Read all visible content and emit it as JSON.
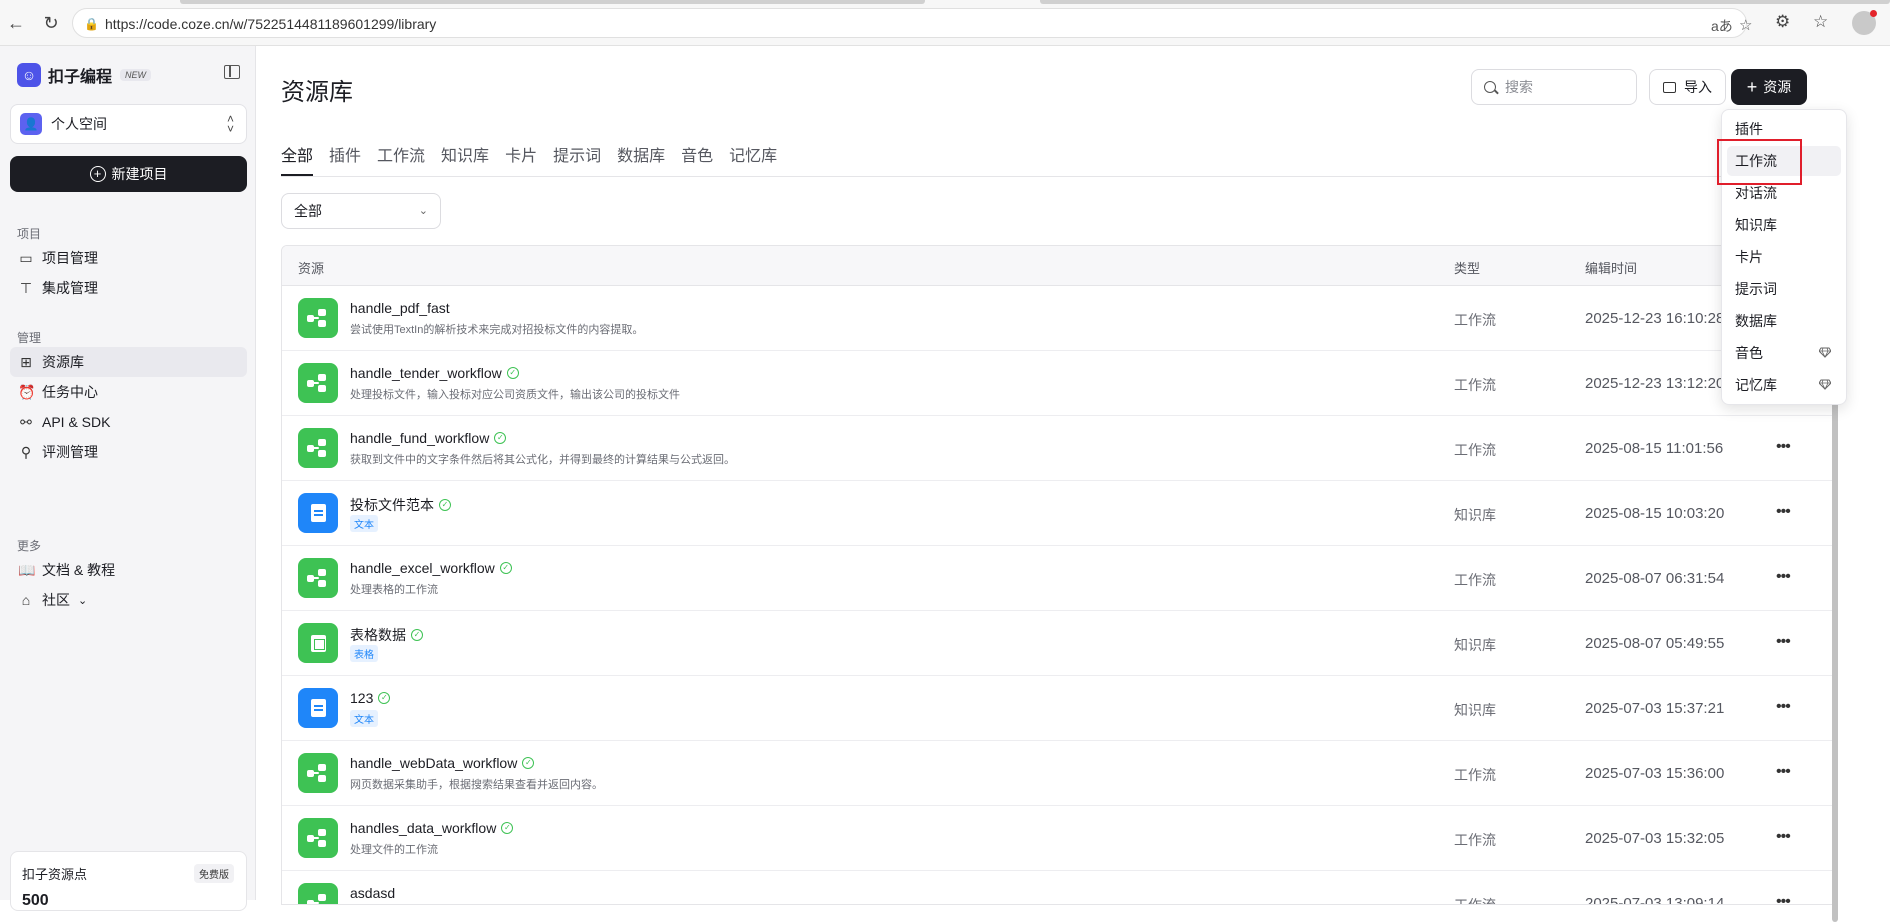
{
  "browser": {
    "url": "https://code.coze.cn/w/7522514481189601299/library"
  },
  "sidebar": {
    "logo_text": "扣子编程",
    "new_badge": "NEW",
    "space_label": "个人空间",
    "new_project_label": "新建项目",
    "sections": [
      {
        "title": "项目",
        "items": [
          {
            "label": "项目管理"
          },
          {
            "label": "集成管理"
          }
        ]
      },
      {
        "title": "管理",
        "items": [
          {
            "label": "资源库"
          },
          {
            "label": "任务中心"
          },
          {
            "label": "API & SDK"
          },
          {
            "label": "评测管理"
          }
        ]
      },
      {
        "title": "更多",
        "items": [
          {
            "label": "文档 & 教程"
          },
          {
            "label": "社区"
          }
        ]
      }
    ],
    "points_title": "扣子资源点",
    "points_badge": "免费版",
    "points_value": "500"
  },
  "main": {
    "title": "资源库",
    "search_placeholder": "搜索",
    "import_label": "导入",
    "resource_label": "资源",
    "tabs": [
      "全部",
      "插件",
      "工作流",
      "知识库",
      "卡片",
      "提示词",
      "数据库",
      "音色",
      "记忆库"
    ],
    "filter_value": "全部",
    "columns": {
      "resource": "资源",
      "type": "类型",
      "edited": "编辑时间"
    },
    "rows": [
      {
        "name": "handle_pdf_fast",
        "desc": "尝试使用TextIn的解析技术来完成对招投标文件的内容提取。",
        "type": "工作流",
        "time": "2025-12-23 16:10:28"
      },
      {
        "name": "handle_tender_workflow",
        "desc": "处理投标文件，输入投标对应公司资质文件，输出该公司的投标文件",
        "type": "工作流",
        "time": "2025-12-23 13:12:20"
      },
      {
        "name": "handle_fund_workflow",
        "desc": "获取到文件中的文字条件然后将其公式化，并得到最终的计算结果与公式返回。",
        "type": "工作流",
        "time": "2025-08-15 11:01:56"
      },
      {
        "name": "投标文件范本",
        "tag": "文本",
        "type": "知识库",
        "time": "2025-08-15 10:03:20"
      },
      {
        "name": "handle_excel_workflow",
        "desc": "处理表格的工作流",
        "type": "工作流",
        "time": "2025-08-07 06:31:54"
      },
      {
        "name": "表格数据",
        "tag": "表格",
        "type": "知识库",
        "time": "2025-08-07 05:49:55"
      },
      {
        "name": "123",
        "tag": "文本",
        "type": "知识库",
        "time": "2025-07-03 15:37:21"
      },
      {
        "name": "handle_webData_workflow",
        "desc": "网页数据采集助手，根据搜索结果查看并返回内容。",
        "type": "工作流",
        "time": "2025-07-03 15:36:00"
      },
      {
        "name": "handles_data_workflow",
        "desc": "处理文件的工作流",
        "type": "工作流",
        "time": "2025-07-03 15:32:05"
      },
      {
        "name": "asdasd",
        "desc": "",
        "type": "工作流",
        "time": "2025-07-03 13:09:14"
      }
    ]
  },
  "dropdown": {
    "items": [
      "插件",
      "工作流",
      "对话流",
      "知识库",
      "卡片",
      "提示词",
      "数据库",
      "音色",
      "记忆库"
    ]
  },
  "colors": {
    "accent": "#1c1d23",
    "workflow": "#3ec254",
    "knowledge": "#1f86f9",
    "highlight": "#e01e2b"
  }
}
